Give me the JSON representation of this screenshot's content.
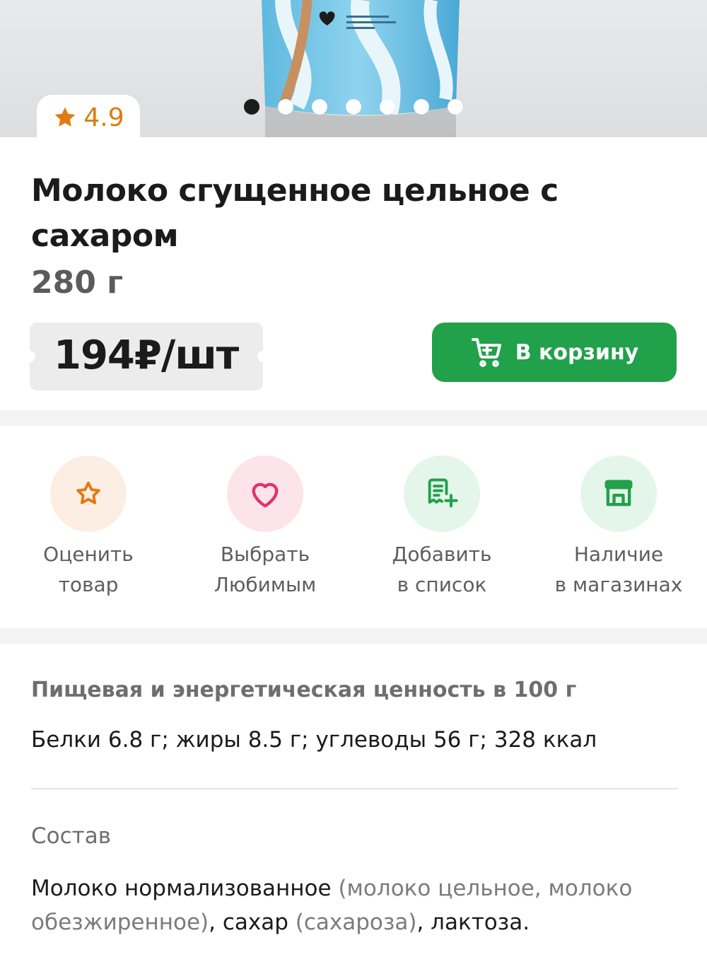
{
  "rating": {
    "value": "4.9",
    "icon": "star-icon",
    "color": "#e07a12"
  },
  "carousel": {
    "total": 7,
    "active": 0
  },
  "product": {
    "title": "Молоко сгущенное цельное с сахаром",
    "weight": "280 г",
    "price": "194₽/шт"
  },
  "cart": {
    "label": "В корзину",
    "icon": "cart-icon",
    "color": "#20a14a"
  },
  "actions": [
    {
      "label": "Оценить\nтовар",
      "icon": "star-outline-icon"
    },
    {
      "label": "Выбрать\nЛюбимым",
      "icon": "heart-icon"
    },
    {
      "label": "Добавить\nв список",
      "icon": "list-add-icon"
    },
    {
      "label": "Наличие\nв магазинах",
      "icon": "store-icon"
    }
  ],
  "nutrition": {
    "heading": "Пищевая и энергетическая ценность в 100 г",
    "value": "Белки 6.8 г; жиры 8.5 г; углеводы 56 г; 328 ккал"
  },
  "composition": {
    "heading": "Состав",
    "parts": [
      {
        "text": "Молоко нормализованное ",
        "muted": false
      },
      {
        "text": "(молоко цельное, молоко обезжиренное)",
        "muted": true
      },
      {
        "text": ", сахар ",
        "muted": false
      },
      {
        "text": "(сахароза)",
        "muted": true
      },
      {
        "text": ", лактоза.",
        "muted": false
      }
    ]
  }
}
